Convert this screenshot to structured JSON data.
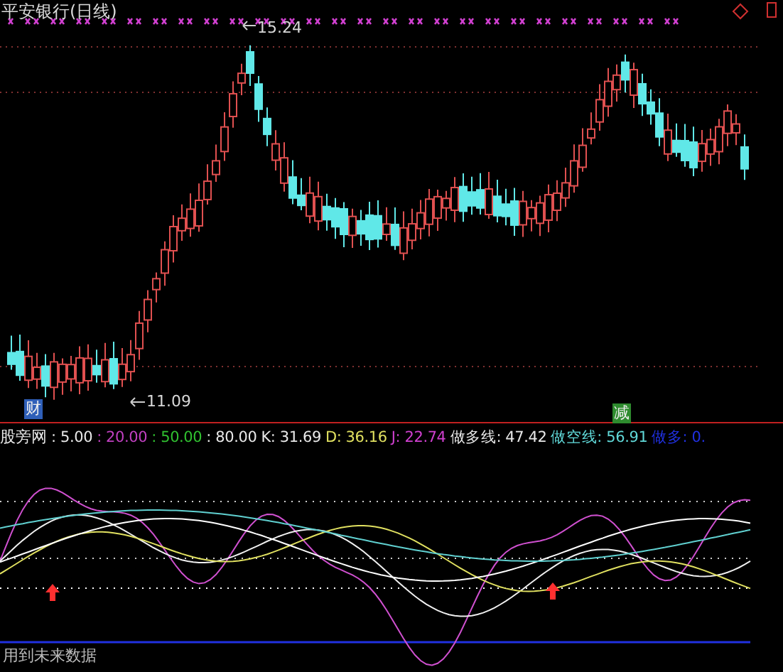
{
  "main_chart": {
    "title": "平安银行(日线)",
    "high_label": "15.24",
    "low_label": "11.09",
    "events": [
      {
        "text": "财",
        "color": "#2f5fb8"
      },
      {
        "text": "减",
        "color": "#2e8b2e"
      }
    ]
  },
  "indicator": {
    "name": "股旁网",
    "values": [
      {
        "text": ": 5.00",
        "color": "#e8e8e8"
      },
      {
        "text": ": 20.00",
        "color": "#c040c0"
      },
      {
        "text": ": 50.00",
        "color": "#30c030"
      },
      {
        "text": ": 80.00",
        "color": "#e8e8e8"
      },
      {
        "text": "K: 31.69",
        "color": "#e8e8e8"
      },
      {
        "text": "D: 36.16",
        "color": "#e0e060"
      },
      {
        "text": "J: 22.74",
        "color": "#d040d0"
      },
      {
        "text": "做多线: 47.42",
        "color": "#e8e8e8"
      },
      {
        "text": "做空线: 56.91",
        "color": "#60d8d8"
      },
      {
        "text": "做多: 0.",
        "color": "#2030e0"
      }
    ]
  },
  "footer_note": "用到未来数据"
}
